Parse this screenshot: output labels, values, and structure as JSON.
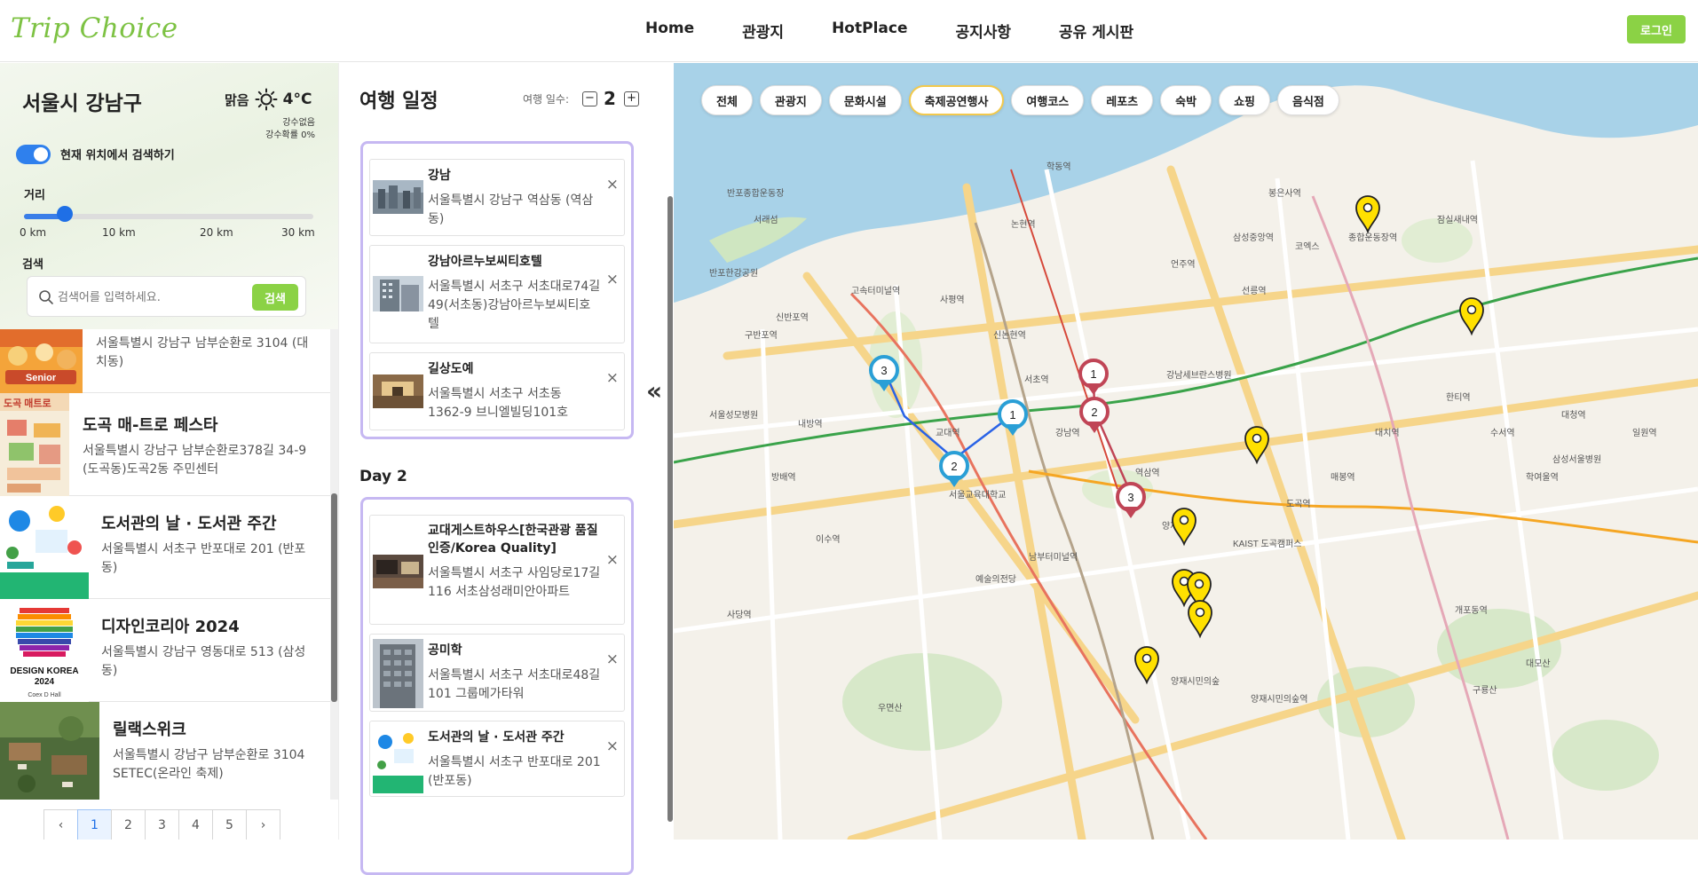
{
  "header": {
    "logo": "Trip Choice",
    "nav": [
      "Home",
      "관광지",
      "HotPlace",
      "공지사항",
      "공유 게시판"
    ],
    "login": "로그인"
  },
  "weather": {
    "city": "서울시 강남구",
    "condition": "맑음",
    "temp": "4°C",
    "precip": "강수없음",
    "precip_prob": "강수확률 0%"
  },
  "location_toggle": {
    "label": "현재 위치에서 검색하기",
    "on": true
  },
  "distance": {
    "label": "거리",
    "ticks": [
      "0 km",
      "10 km",
      "20 km",
      "30 km"
    ],
    "value_km": 5
  },
  "search": {
    "label": "검색",
    "placeholder": "검색어를 입력하세요.",
    "button": "검색"
  },
  "results": [
    {
      "title": "",
      "addr": "서울특별시 강남구 남부순환로 3104 (대치동)"
    },
    {
      "title": "도곡 매-트로 페스타",
      "addr": "서울특별시 강남구 남부순환로378길 34-9 (도곡동)도곡2동 주민센터"
    },
    {
      "title": "도서관의 날 · 도서관 주간",
      "addr": "서울특별시 서초구 반포대로 201 (반포동)"
    },
    {
      "title": "디자인코리아 2024",
      "addr": "서울특별시 강남구 영동대로 513 (삼성동)"
    },
    {
      "title": "릴랙스위크",
      "addr": "서울특별시 강남구 남부순환로 3104 SETEC(온라인 축제)"
    }
  ],
  "pager": {
    "pages": [
      "1",
      "2",
      "3",
      "4",
      "5"
    ],
    "prev": "‹",
    "next": "›",
    "current": "1"
  },
  "itinerary": {
    "title": "여행 일정",
    "days_label": "여행 일수:",
    "days": "2",
    "day2_label": "Day 2",
    "day1": [
      {
        "title": "강남",
        "addr": "서울특별시 강남구 역삼동 (역삼동)"
      },
      {
        "title": "강남아르누보씨티호텔",
        "addr": "서울특별시 서초구 서초대로74길 49(서초동)강남아르누보씨티호텔"
      },
      {
        "title": "길상도예",
        "addr": "서울특별시 서초구 서초동 1362-9 브니엘빌딩101호"
      }
    ],
    "day2": [
      {
        "title": "교대게스트하우스[한국관광 품질인증/Korea Quality]",
        "addr": "서울특별시 서초구 사임당로17길 116 서초삼성래미안아파트"
      },
      {
        "title": "공미학",
        "addr": "서울특별시 서초구 서초대로48길 101 그룹메가타워"
      },
      {
        "title": "도서관의 날 · 도서관 주간",
        "addr": "서울특별시 서초구 반포대로 201 (반포동)"
      }
    ],
    "remove": "×"
  },
  "collapse": "«",
  "filters": [
    "전체",
    "관광지",
    "문화시설",
    "축제공연행사",
    "여행코스",
    "레포츠",
    "숙박",
    "쇼핑",
    "음식점"
  ],
  "active_filter": "축제공연행사",
  "map": {
    "route_day1": [
      "1",
      "2",
      "3"
    ],
    "route_day2": [
      "1",
      "2",
      "3"
    ],
    "labels": [
      "반포한강공원",
      "서래섬",
      "반포종합운동장",
      "고속터미널역",
      "신반포역",
      "구반포역",
      "사평역",
      "신논현역",
      "논현역",
      "강남역",
      "역삼역",
      "선릉역",
      "삼성중앙역",
      "봉은사역",
      "종합운동장역",
      "잠실새내역",
      "대치역",
      "학여울역",
      "매봉역",
      "도곡역",
      "양재역",
      "양재시민의숲역",
      "교대역",
      "서초역",
      "방배역",
      "내방역",
      "이수역",
      "사당역",
      "남부터미널역",
      "예술의전당",
      "우면산",
      "KAIST 도곡캠퍼스",
      "서울교육대학교",
      "코엑스",
      "대모산",
      "구룡산",
      "학동역",
      "언주역",
      "한티역",
      "개포동역",
      "대청역",
      "일원역",
      "수서역",
      "삼성서울병원",
      "양재시민의숲",
      "서울성모병원",
      "강남세브란스병원"
    ],
    "colors": {
      "day1_route": "#2a63e6",
      "day1_pin": "#2a9fd6",
      "day2_pin": "#c04556",
      "festival_pin": "#ffe000"
    }
  }
}
